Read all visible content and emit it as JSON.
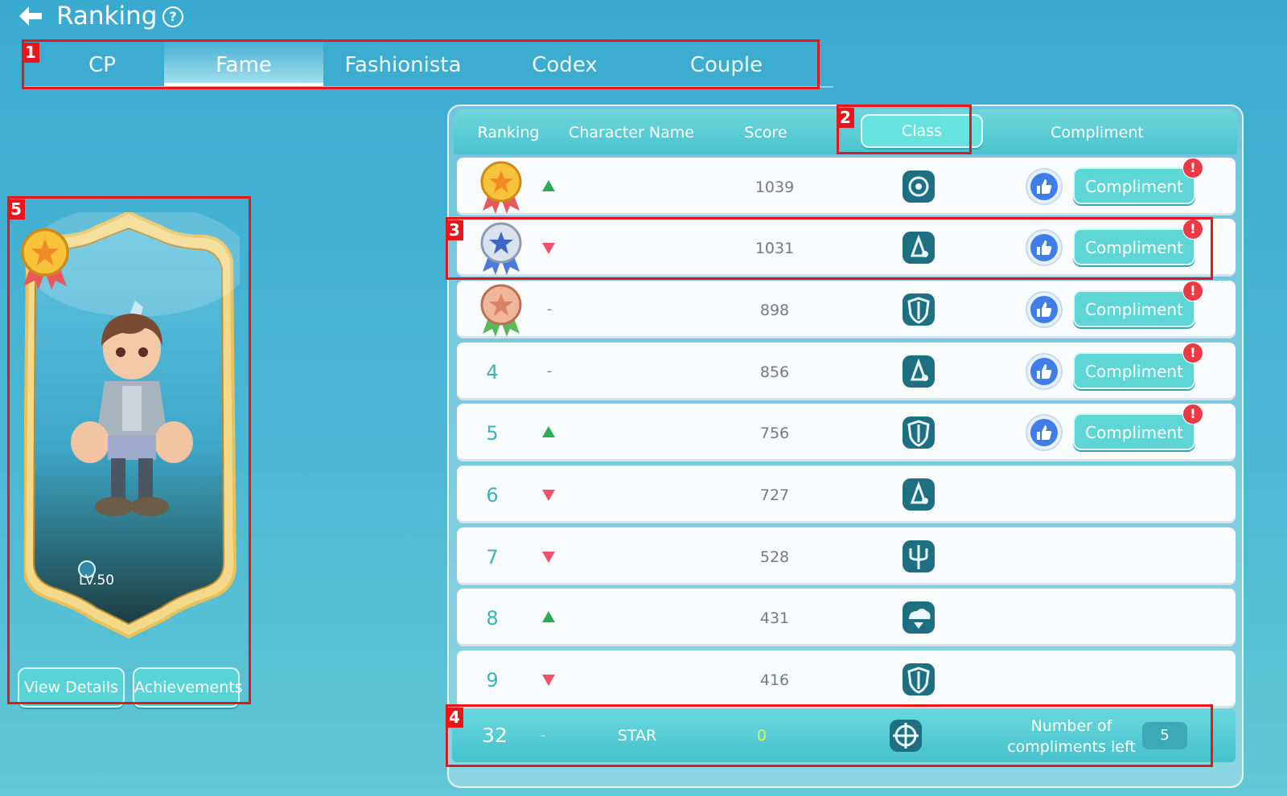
{
  "header": {
    "title": "Ranking",
    "help": "?"
  },
  "tabs": [
    {
      "label": "CP"
    },
    {
      "label": "Fame"
    },
    {
      "label": "Fashionista"
    },
    {
      "label": "Codex"
    },
    {
      "label": "Couple"
    }
  ],
  "annotations": [
    "1",
    "2",
    "3",
    "4",
    "5"
  ],
  "card": {
    "level": "LV.50",
    "view_details": "View Details",
    "achievements": "Achievements"
  },
  "table": {
    "headers": {
      "ranking": "Ranking",
      "character_name": "Character Name",
      "score": "Score",
      "class": "Class",
      "compliment": "Compliment"
    },
    "compliment_label": "Compliment",
    "alert": "!",
    "rows": [
      {
        "rank": "",
        "medal": "gold",
        "trend": "up",
        "score": "1039",
        "class_icon": "target-class-icon",
        "compliment": true
      },
      {
        "rank": "",
        "medal": "silver",
        "trend": "down",
        "score": "1031",
        "class_icon": "mage-class-icon",
        "compliment": true
      },
      {
        "rank": "",
        "medal": "bronze",
        "trend": "same",
        "trend_text": "-",
        "score": "898",
        "class_icon": "shield-class-icon",
        "compliment": true
      },
      {
        "rank": "4",
        "trend": "same",
        "trend_text": "-",
        "score": "856",
        "class_icon": "mage-class-icon",
        "compliment": true
      },
      {
        "rank": "5",
        "trend": "up",
        "score": "756",
        "class_icon": "shield-class-icon",
        "compliment": true
      },
      {
        "rank": "6",
        "trend": "down",
        "score": "727",
        "class_icon": "mage-class-icon",
        "compliment": false
      },
      {
        "rank": "7",
        "trend": "down",
        "score": "528",
        "class_icon": "trident-class-icon",
        "compliment": false
      },
      {
        "rank": "8",
        "trend": "up",
        "score": "431",
        "class_icon": "cloud-class-icon",
        "compliment": false
      },
      {
        "rank": "9",
        "trend": "down",
        "score": "416",
        "class_icon": "shield-class-icon",
        "compliment": false
      }
    ]
  },
  "my_row": {
    "rank": "32",
    "trend_text": "-",
    "name": "STAR",
    "score": "0",
    "compliments_label": "Number of compliments left",
    "compliments_left": "5"
  },
  "colors": {
    "accent": "#58d3d6",
    "highlight": "#e8161b",
    "up": "#2bab5a",
    "down": "#f0526a"
  }
}
